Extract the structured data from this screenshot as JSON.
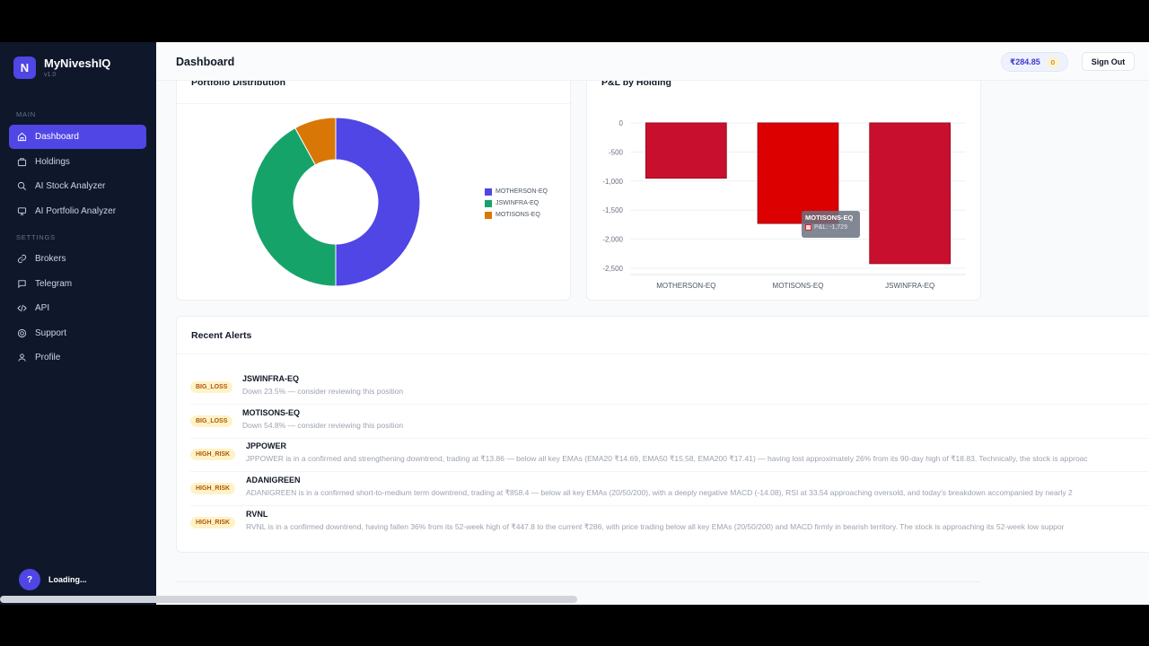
{
  "app": {
    "logo_letter": "N",
    "name": "MyNiveshIQ",
    "version": "v1.0"
  },
  "sidebar": {
    "main_label": "MAIN",
    "settings_label": "SETTINGS",
    "main_items": [
      {
        "label": "Dashboard",
        "icon": "home-icon",
        "active": true
      },
      {
        "label": "Holdings",
        "icon": "briefcase-icon"
      },
      {
        "label": "AI Stock Analyzer",
        "icon": "search-icon"
      },
      {
        "label": "AI Portfolio Analyzer",
        "icon": "monitor-icon"
      }
    ],
    "settings_items": [
      {
        "label": "Brokers",
        "icon": "link-icon"
      },
      {
        "label": "Telegram",
        "icon": "chat-icon"
      },
      {
        "label": "API",
        "icon": "code-icon"
      },
      {
        "label": "Support",
        "icon": "lifebuoy-icon"
      },
      {
        "label": "Profile",
        "icon": "user-icon"
      }
    ],
    "footer": {
      "help_glyph": "?",
      "status": "Loading..."
    }
  },
  "header": {
    "title": "Dashboard",
    "balance": "₹284.85",
    "balance_badge": "0",
    "signout": "Sign Out"
  },
  "portfolio_card": {
    "title": "Portfolio Distribution"
  },
  "pnl_card": {
    "title": "P&L by Holding",
    "tooltip": {
      "title": "MOTISONS-EQ",
      "body": "P&L: -1,729"
    }
  },
  "chart_data": [
    {
      "type": "pie",
      "title": "Portfolio Distribution",
      "categories": [
        "MOTHERSON-EQ",
        "JSWINFRA-EQ",
        "MOTISONS-EQ"
      ],
      "values": [
        50,
        42,
        8
      ],
      "colors": [
        "#4f46e5",
        "#16a36a",
        "#d97706"
      ],
      "legend": "right"
    },
    {
      "type": "bar",
      "title": "P&L by Holding",
      "categories": [
        "MOTHERSON-EQ",
        "MOTISONS-EQ",
        "JSWINFRA-EQ"
      ],
      "values": [
        -950,
        -1729,
        -2420
      ],
      "y_ticks": [
        "0",
        "-500",
        "-1,000",
        "-1,500",
        "-2,000",
        "-2,500"
      ],
      "ylim": [
        -2500,
        0
      ],
      "colors": [
        "#c8102e",
        "#dc0000",
        "#c8102e"
      ],
      "grid": true
    }
  ],
  "alerts": {
    "title": "Recent Alerts",
    "items": [
      {
        "badge": "BIG_LOSS",
        "symbol": "JSWINFRA-EQ",
        "desc": "Down 23.5% — consider reviewing this position"
      },
      {
        "badge": "BIG_LOSS",
        "symbol": "MOTISONS-EQ",
        "desc": "Down 54.8% — consider reviewing this position"
      },
      {
        "badge": "HIGH_RISK",
        "symbol": "JPPOWER",
        "desc": "JPPOWER is in a confirmed and strengthening downtrend, trading at ₹13.86 — below all key EMAs (EMA20 ₹14.69, EMA50 ₹15.58, EMA200 ₹17.41) — having lost approximately 26% from its 90-day high of ₹18.83. Technically, the stock is approac"
      },
      {
        "badge": "HIGH_RISK",
        "symbol": "ADANIGREEN",
        "desc": "ADANIGREEN is in a confirmed short-to-medium term downtrend, trading at ₹858.4 — below all key EMAs (20/50/200), with a deeply negative MACD (-14.08), RSI at 33.54 approaching oversold, and today's breakdown accompanied by nearly 2"
      },
      {
        "badge": "HIGH_RISK",
        "symbol": "RVNL",
        "desc": "RVNL is in a confirmed downtrend, having fallen 36% from its 52-week high of ₹447.8 to the current ₹286, with price trading below all key EMAs (20/50/200) and MACD firmly in bearish territory. The stock is approaching its 52-week low suppor"
      }
    ]
  }
}
